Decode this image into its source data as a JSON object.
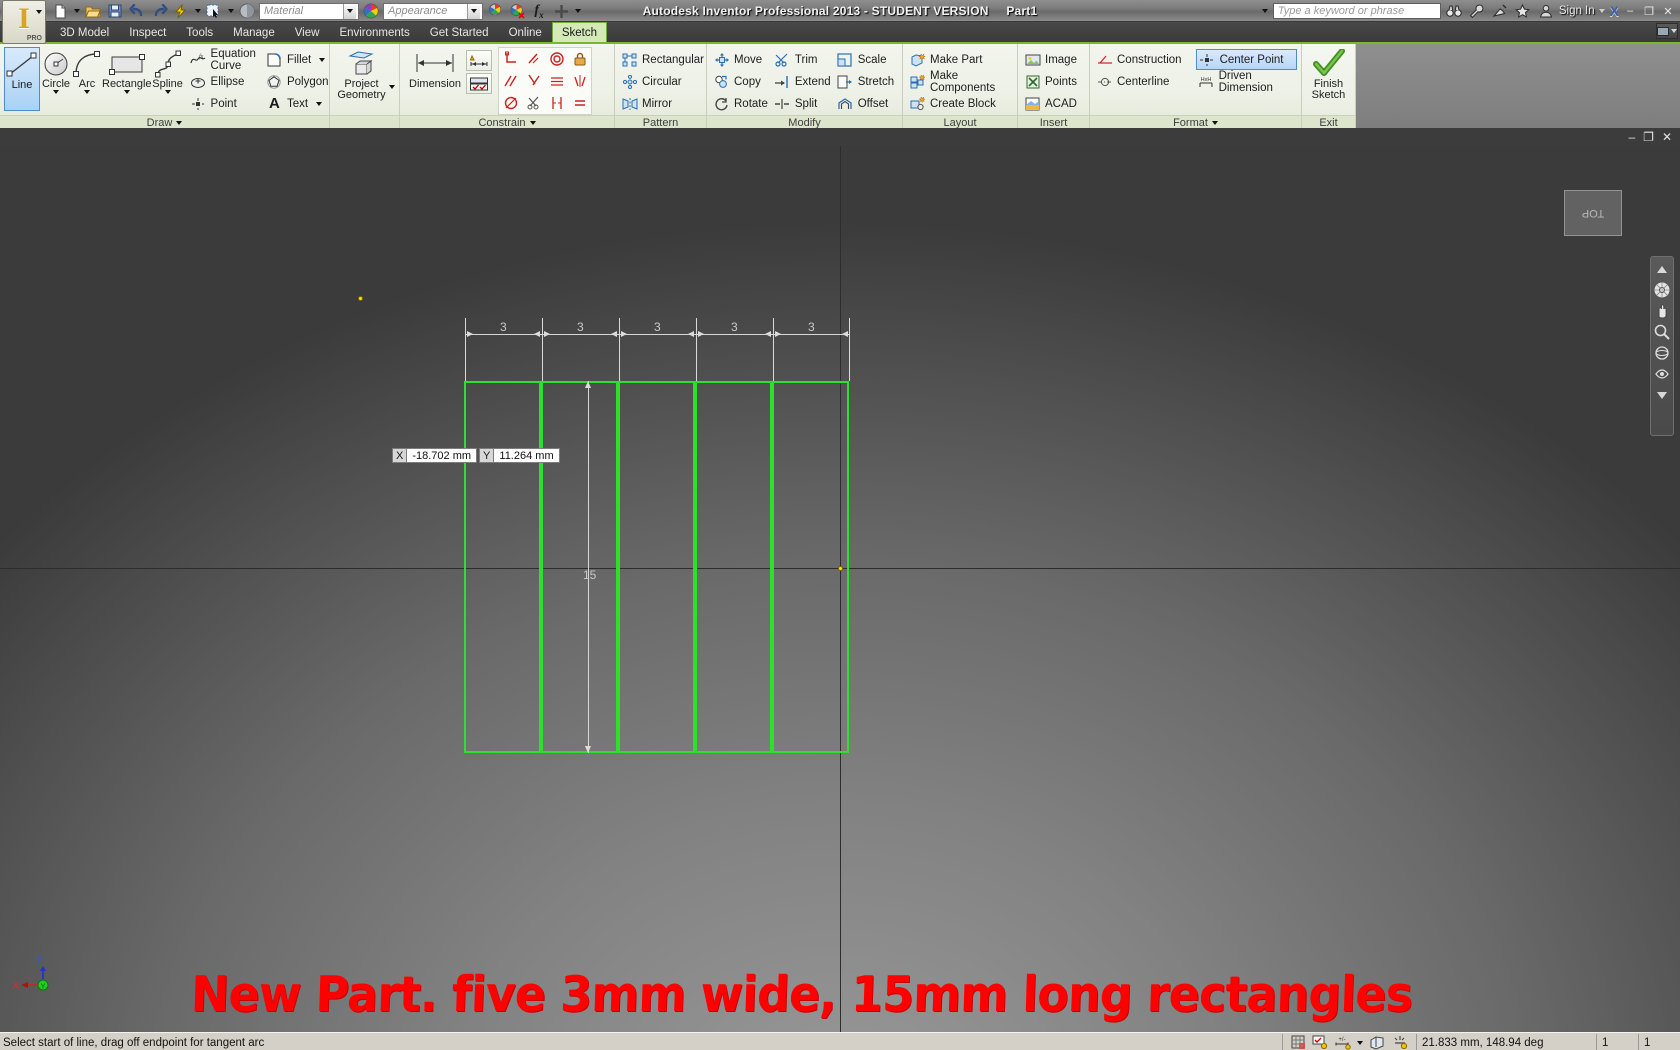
{
  "titlebar": {
    "app_title": "Autodesk Inventor Professional 2013 - STUDENT VERSION",
    "document_name": "Part1",
    "material_placeholder": "Material",
    "appearance_placeholder": "Appearance",
    "search_placeholder": "Type a keyword or phrase",
    "sign_in": "Sign In",
    "pro_badge": "PRO",
    "fx_label": "fx",
    "minimize": "–",
    "restore": "❐",
    "close": "✕"
  },
  "tabs": [
    {
      "label": "3D Model",
      "active": false
    },
    {
      "label": "Inspect",
      "active": false
    },
    {
      "label": "Tools",
      "active": false
    },
    {
      "label": "Manage",
      "active": false
    },
    {
      "label": "View",
      "active": false
    },
    {
      "label": "Environments",
      "active": false
    },
    {
      "label": "Get Started",
      "active": false
    },
    {
      "label": "Online",
      "active": false
    },
    {
      "label": "Sketch",
      "active": true
    }
  ],
  "ribbon": {
    "panels": [
      {
        "title": "Draw",
        "has_dropdown": true,
        "big_buttons": [
          {
            "label": "Line",
            "icon": "line-icon",
            "selected": true,
            "dropdown": false
          },
          {
            "label": "Circle",
            "icon": "circle-icon",
            "selected": false,
            "dropdown": true
          },
          {
            "label": "Arc",
            "icon": "arc-icon",
            "selected": false,
            "dropdown": true
          },
          {
            "label": "Rectangle",
            "icon": "rectangle-icon",
            "selected": false,
            "dropdown": true
          },
          {
            "label": "Spline",
            "icon": "spline-icon",
            "selected": false,
            "dropdown": true
          }
        ],
        "small_columns": [
          [
            {
              "label": "Equation Curve",
              "icon": "equation-curve-icon"
            },
            {
              "label": "Ellipse",
              "icon": "ellipse-icon"
            },
            {
              "label": "Point",
              "icon": "point-icon"
            }
          ],
          [
            {
              "label": "Fillet",
              "icon": "fillet-icon",
              "dropdown": true
            },
            {
              "label": "Polygon",
              "icon": "polygon-icon"
            },
            {
              "label": "Text",
              "icon": "text-icon",
              "dropdown": true
            }
          ]
        ]
      },
      {
        "title": "",
        "big_buttons": [
          {
            "label": "Project\nGeometry",
            "icon": "project-geometry-icon",
            "dropdown": true
          }
        ]
      },
      {
        "title": "Constrain",
        "has_dropdown": true,
        "big_buttons": [
          {
            "label": "Dimension",
            "icon": "dimension-icon"
          }
        ],
        "constraint_icons": [
          "perpendicular-constraint-icon",
          "parallel-constraint-icon",
          "tangent-constraint-icon",
          "fix-constraint-icon",
          "collinear-constraint-icon",
          "coincident-constraint-icon",
          "concentric-constraint-icon",
          "symmetric-constraint-icon",
          "equal-constraint-icon",
          "smooth-constraint-icon",
          "horizontal-constraint-icon",
          "vertical-constraint-icon"
        ]
      },
      {
        "title": "Pattern",
        "small_columns": [
          [
            {
              "label": "Rectangular",
              "icon": "rectangular-pattern-icon"
            },
            {
              "label": "Circular",
              "icon": "circular-pattern-icon"
            },
            {
              "label": "Mirror",
              "icon": "mirror-icon"
            }
          ]
        ]
      },
      {
        "title": "Modify",
        "small_columns": [
          [
            {
              "label": "Move",
              "icon": "move-icon"
            },
            {
              "label": "Copy",
              "icon": "copy-icon"
            },
            {
              "label": "Rotate",
              "icon": "rotate-icon"
            }
          ],
          [
            {
              "label": "Trim",
              "icon": "trim-icon"
            },
            {
              "label": "Extend",
              "icon": "extend-icon"
            },
            {
              "label": "Split",
              "icon": "split-icon"
            }
          ],
          [
            {
              "label": "Scale",
              "icon": "scale-icon"
            },
            {
              "label": "Stretch",
              "icon": "stretch-icon"
            },
            {
              "label": "Offset",
              "icon": "offset-icon"
            }
          ]
        ]
      },
      {
        "title": "Layout",
        "small_columns": [
          [
            {
              "label": "Make Part",
              "icon": "make-part-icon"
            },
            {
              "label": "Make Components",
              "icon": "make-components-icon"
            },
            {
              "label": "Create Block",
              "icon": "create-block-icon"
            }
          ]
        ]
      },
      {
        "title": "Insert",
        "small_columns": [
          [
            {
              "label": "Image",
              "icon": "image-icon"
            },
            {
              "label": "Points",
              "icon": "points-icon"
            },
            {
              "label": "ACAD",
              "icon": "acad-icon"
            }
          ]
        ]
      },
      {
        "title": "Format",
        "has_dropdown": true,
        "small_columns": [
          [
            {
              "label": "Construction",
              "icon": "construction-icon"
            },
            {
              "label": "Centerline",
              "icon": "centerline-icon"
            }
          ],
          [
            {
              "label": "Center Point",
              "icon": "center-point-icon",
              "selected": true
            },
            {
              "label": "Driven Dimension",
              "icon": "driven-dimension-icon"
            }
          ]
        ]
      },
      {
        "title": "Exit",
        "big_buttons": [
          {
            "label": "Finish\nSketch",
            "icon": "finish-sketch-check-icon"
          }
        ]
      }
    ]
  },
  "canvas": {
    "coordinate_tooltip": {
      "x_key": "X",
      "x_value": "-18.702 mm",
      "y_key": "Y",
      "y_value": "11.264 mm"
    },
    "horizontal_dimensions": [
      "3",
      "3",
      "3",
      "3",
      "3"
    ],
    "vertical_dimension": "15",
    "annotation": "New Part. five 3mm wide, 15mm long rectangles",
    "annotation_color": "#fe0000",
    "sketch_color": "#2ee02e",
    "viewcube_label": "TOP",
    "rect_count": 5
  },
  "statusbar": {
    "message": "Select start of line, drag off endpoint for tangent arc",
    "coordinates": "21.833 mm, 148.94 deg",
    "field_1": "1",
    "field_2": "1"
  }
}
